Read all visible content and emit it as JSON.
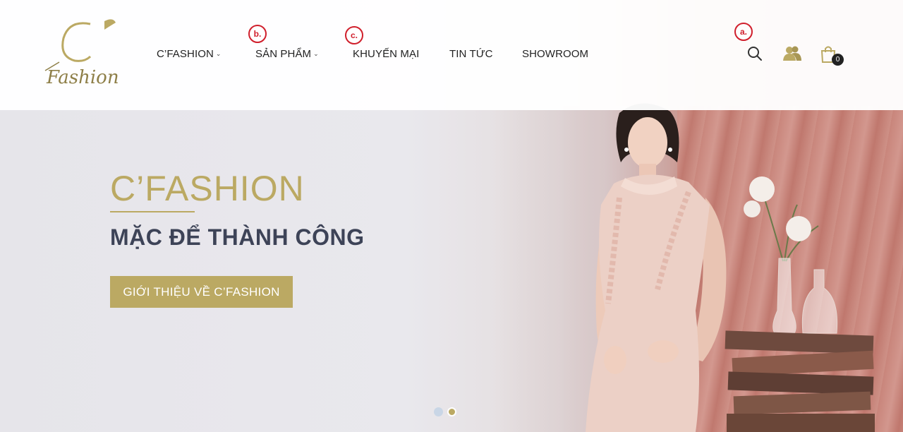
{
  "brand": {
    "logo_letter": "C",
    "logo_script": "Fashion",
    "accent_color": "#bba963"
  },
  "nav": {
    "items": [
      {
        "label": "C’FASHION",
        "has_dropdown": true
      },
      {
        "label": "SẢN PHẨM",
        "has_dropdown": true
      },
      {
        "label": "KHUYẾN MẠI",
        "has_dropdown": false
      },
      {
        "label": "TIN TỨC",
        "has_dropdown": false
      },
      {
        "label": "SHOWROOM",
        "has_dropdown": false
      }
    ],
    "dropdown_glyph": "⌄"
  },
  "markers": {
    "a": "a.",
    "b": "b.",
    "c": "c."
  },
  "header_icons": {
    "search": "search-icon",
    "account": "users-icon",
    "cart": "shopping-bag-icon",
    "cart_count": "0"
  },
  "hero": {
    "title": "C’FASHION",
    "subtitle": "MẶC ĐỂ THÀNH CÔNG",
    "button_label": "GIỚI THIỆU VỀ C’FASHION",
    "slides": 2,
    "active_slide": 2
  },
  "colors": {
    "title": "#bba963",
    "subtitle": "#3d4357",
    "button_bg": "#bba963",
    "marker": "#d01f2c"
  }
}
